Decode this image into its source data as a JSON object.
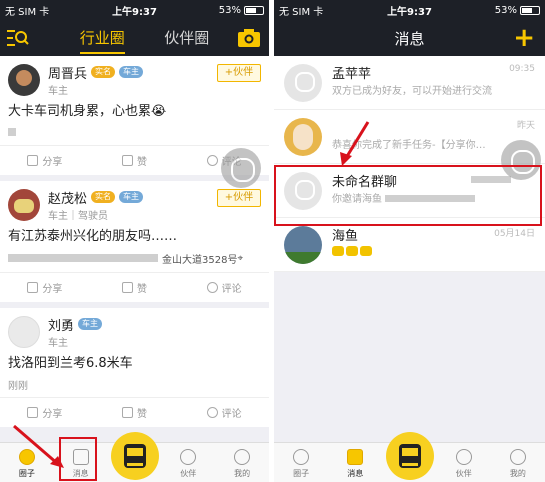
{
  "left": {
    "status": {
      "carrier": "无 SIM 卡",
      "time": "上午9:37",
      "battery": "53%",
      "battery_level": 0.53
    },
    "nav": {
      "tabs": [
        "行业圈",
        "伙伴圈"
      ],
      "active_tab": 0
    },
    "posts": [
      {
        "name": "周晋兵",
        "badges": [
          "实名",
          "车主"
        ],
        "role": "车主",
        "content": "大卡车司机身累，心也累",
        "emoji": "😭",
        "follow_label": "+伙伴",
        "actions": [
          "分享",
          "赞",
          "评论"
        ]
      },
      {
        "name": "赵茂松",
        "badges": [
          "实名",
          "车主"
        ],
        "role": "车主｜驾驶员",
        "content": "有江苏泰州兴化的朋友吗……",
        "location": "金山大道3528号",
        "follow_label": "+伙伴",
        "actions": [
          "分享",
          "赞",
          "评论"
        ]
      },
      {
        "name": "刘勇",
        "badges": [
          "车主"
        ],
        "role": "车主",
        "content": "找洛阳到兰考6.8米车",
        "time": "刚刚",
        "actions": [
          "分享",
          "赞",
          "评论"
        ]
      }
    ],
    "tabbar": {
      "items": [
        "圈子",
        "消息",
        "",
        "伙伴",
        "我的"
      ],
      "active": 0
    }
  },
  "right": {
    "status": {
      "carrier": "无 SIM 卡",
      "time": "上午9:37",
      "battery": "53%",
      "battery_level": 0.53
    },
    "nav": {
      "title": "消息",
      "plus": "+"
    },
    "messages": [
      {
        "title": "孟苹苹",
        "subtitle": "双方已成为好友，可以开始进行交流",
        "time": "09:35"
      },
      {
        "title": "",
        "subtitle": "恭喜你完成了新手任务-【分享你…",
        "time": "昨天"
      },
      {
        "title": "未命名群聊",
        "subtitle": "你邀请海鱼",
        "time": ""
      },
      {
        "title": "海鱼",
        "subtitle": "",
        "time": "05月14日"
      }
    ],
    "tabbar": {
      "items": [
        "圈子",
        "消息",
        "",
        "伙伴",
        "我的"
      ],
      "active": 1
    }
  },
  "colors": {
    "accent": "#f7c600",
    "navbar": "#1d2027",
    "highlight": "#d8121c"
  }
}
